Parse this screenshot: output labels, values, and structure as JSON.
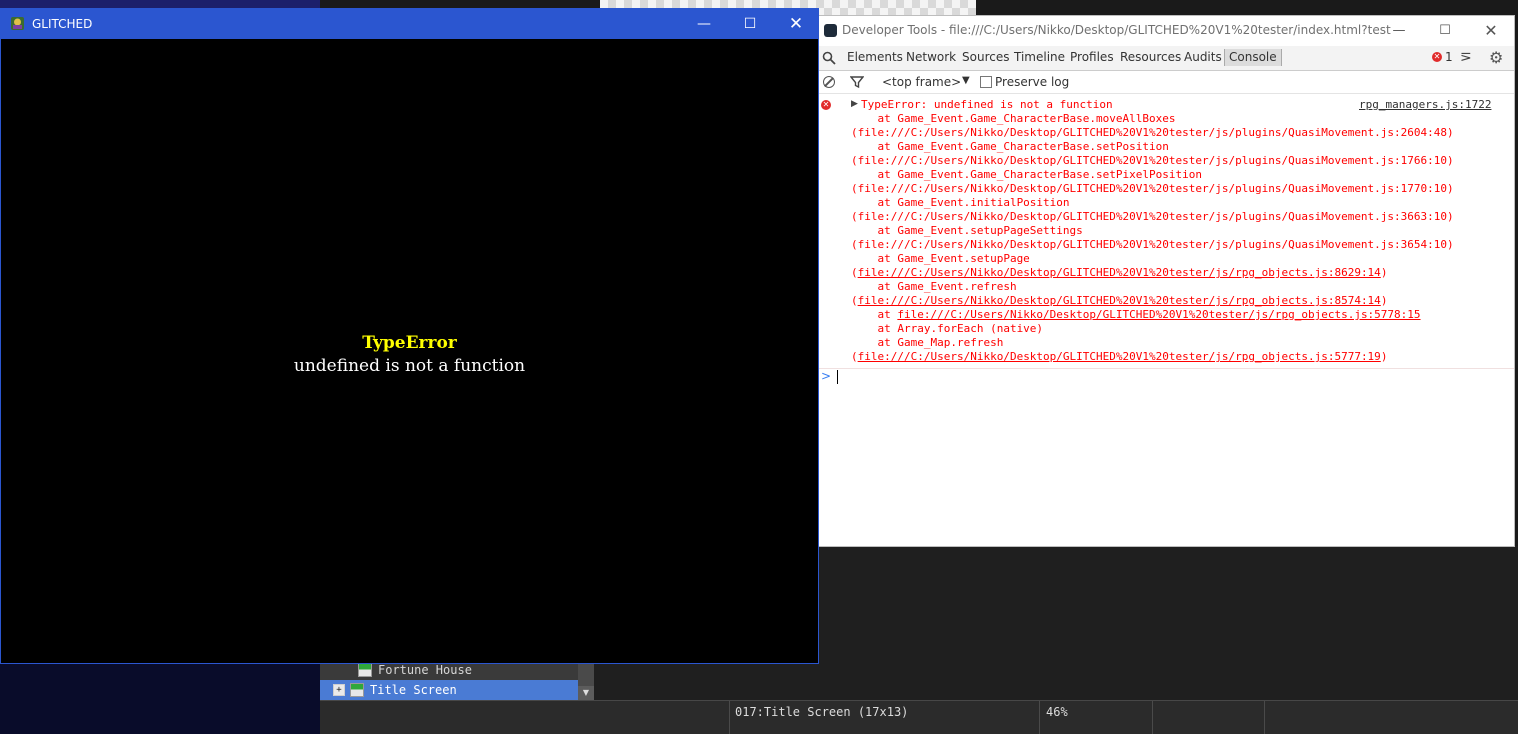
{
  "editor": {
    "tree_items": [
      "Fortune House",
      "Title Screen"
    ],
    "tree_expander": "+",
    "status_map": "017:Title Screen (17x13)",
    "status_zoom": "46%"
  },
  "devtools": {
    "title": "Developer Tools - file:///C:/Users/Nikko/Desktop/GLITCHED%20V1%20tester/index.html?test",
    "tabs": [
      "Elements",
      "Network",
      "Sources",
      "Timeline",
      "Profiles",
      "Resources",
      "Audits",
      "Console"
    ],
    "error_count": "1",
    "frame_select": "<top frame>",
    "preserve_log": "Preserve log",
    "error": {
      "headline": "TypeError: undefined is not a function",
      "source": "rpg_managers.js:1722",
      "l1": "    at Game_Event.Game_CharacterBase.moveAllBoxes",
      "l2": "(file:///C:/Users/Nikko/Desktop/GLITCHED%20V1%20tester/js/plugins/QuasiMovement.js:2604:48)",
      "l3": "    at Game_Event.Game_CharacterBase.setPosition",
      "l4": "(file:///C:/Users/Nikko/Desktop/GLITCHED%20V1%20tester/js/plugins/QuasiMovement.js:1766:10)",
      "l5": "    at Game_Event.Game_CharacterBase.setPixelPosition",
      "l6": "(file:///C:/Users/Nikko/Desktop/GLITCHED%20V1%20tester/js/plugins/QuasiMovement.js:1770:10)",
      "l7": "    at Game_Event.initialPosition",
      "l8": "(file:///C:/Users/Nikko/Desktop/GLITCHED%20V1%20tester/js/plugins/QuasiMovement.js:3663:10)",
      "l9": "    at Game_Event.setupPageSettings",
      "l10": "(file:///C:/Users/Nikko/Desktop/GLITCHED%20V1%20tester/js/plugins/QuasiMovement.js:3654:10)",
      "l11": "    at Game_Event.setupPage",
      "l12_link": "file:///C:/Users/Nikko/Desktop/GLITCHED%20V1%20tester/js/rpg_objects.js:8629:14",
      "l13": "    at Game_Event.refresh",
      "l14_link": "file:///C:/Users/Nikko/Desktop/GLITCHED%20V1%20tester/js/rpg_objects.js:8574:14",
      "l15_prefix": "    at ",
      "l15_link": "file:///C:/Users/Nikko/Desktop/GLITCHED%20V1%20tester/js/rpg_objects.js:5778:15",
      "l16": "    at Array.forEach (native)",
      "l17": "    at Game_Map.refresh",
      "l18_link": "file:///C:/Users/Nikko/Desktop/GLITCHED%20V1%20tester/js/rpg_objects.js:5777:19"
    },
    "prompt": ">"
  },
  "game": {
    "title": "GLITCHED",
    "error_title": "TypeError",
    "error_message": "undefined is not a function"
  },
  "colors": {
    "titlebar_blue": "#2b56d0",
    "console_error": "#ff0000",
    "error_title_yellow": "#ffff00",
    "tree_selected": "#4a7bd4"
  }
}
